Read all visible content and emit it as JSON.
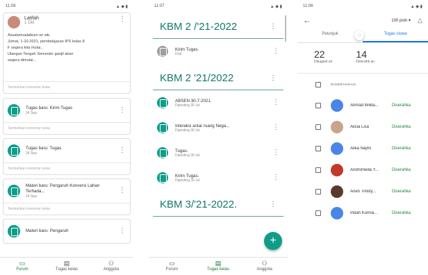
{
  "phone1": {
    "status": "11:06",
    "post": {
      "author": "Latifah",
      "date": "1 Okt",
      "body_lines": [
        "Assalamualaikum wr wb.",
        "Jumat, 1-10-2021, pembelajaran IPS kelas 8",
        "F segera kita mulai..",
        "Ulangan Tengah Semester ganjil akan",
        "segera dimulai..."
      ],
      "comment_placeholder": "Tambahkan komentar kelas"
    },
    "tasks": [
      {
        "title": "Tugas baru: Kirim Tugas",
        "date": "24 Sep",
        "comment": "Tambahkan komentar kelas"
      },
      {
        "title": "Tugas baru: Tugas",
        "date": "24 Sep",
        "comment": "Tambahkan komentar kelas"
      },
      {
        "title": "Materi baru: Pengaruh Konversi Lahan Terhada...",
        "date": "24 Sep",
        "comment": "Tambahkan komentar kelas"
      },
      {
        "title": "Materi baru: Pengaruh",
        "date": "",
        "comment": ""
      }
    ],
    "nav": [
      "Forum",
      "Tugas kelas",
      "Anggota"
    ]
  },
  "phone2": {
    "status": "11:07",
    "topics": [
      {
        "title": "KBM 2 /'21-2022",
        "items": [
          {
            "title": "Kirim Tugas",
            "date": "Draf",
            "grey": true
          }
        ]
      },
      {
        "title": "KBM 2 '21/2022",
        "items": [
          {
            "title": "ABSEN 30-7-2021.",
            "date": "Diposting 30 Jul",
            "grey": false
          },
          {
            "title": "Interaksi antar ruang Nega...",
            "date": "Diposting 30 Jul",
            "grey": false
          },
          {
            "title": "Tugas.",
            "date": "Diposting 30 Jul",
            "grey": false
          },
          {
            "title": "Kirim Tugas.",
            "date": "Diposting 30 Jul",
            "grey": false
          }
        ]
      },
      {
        "title": "KBM 3/'21-2022.",
        "items": []
      }
    ],
    "fab": "+",
    "nav": [
      "Forum",
      "Tugas kelas",
      "Anggota"
    ]
  },
  "phone3": {
    "status": "11:06",
    "points": "100 poin",
    "tabs": [
      "Petunjuk",
      "Tugas siswa"
    ],
    "stats": [
      {
        "n": "22",
        "label": "Ditugask an"
      },
      {
        "n": "14",
        "label": "Diserahk an"
      }
    ],
    "section": "DISERAHKAN",
    "students": [
      {
        "name": "Ahmad Wilda...",
        "status": "Diserahka",
        "color": "#4a86e8"
      },
      {
        "name": "Alicia Lisa",
        "status": "Diserahka",
        "color": "#c9a48a"
      },
      {
        "name": "Alika Najmi",
        "status": "Diserahka",
        "color": "#4a86e8"
      },
      {
        "name": "Andromeda Y...",
        "status": "Diserahka",
        "color": "#c0392b"
      },
      {
        "name": "Arien Trilisty...",
        "status": "Diserahka",
        "color": "#5a3a2e"
      },
      {
        "name": "Indah Kurnia...",
        "status": "Diserahka",
        "color": "#4a86e8"
      }
    ]
  }
}
